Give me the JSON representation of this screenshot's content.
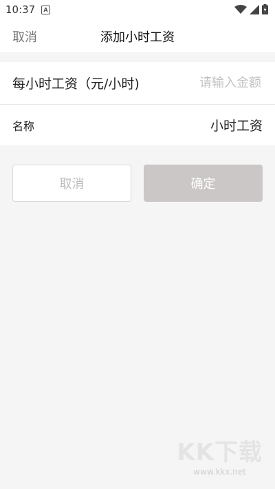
{
  "status_bar": {
    "time": "10:37",
    "notification_icon": "A",
    "icons": [
      "wifi-icon",
      "signal-icon",
      "battery-icon"
    ]
  },
  "nav": {
    "cancel_label": "取消",
    "title": "添加小时工资"
  },
  "form": {
    "hourly_wage": {
      "label": "每小时工资（元/小时)",
      "placeholder": "请输入金额",
      "value": ""
    },
    "name": {
      "label": "名称",
      "value": "小时工资"
    }
  },
  "actions": {
    "cancel_label": "取消",
    "confirm_label": "确定"
  },
  "watermark": {
    "logo": "KK下载",
    "url": "www.kkx.net"
  },
  "colors": {
    "confirm_bg": "#cbc7c6",
    "background": "#f5f5f5",
    "placeholder": "#c2c2c2"
  }
}
